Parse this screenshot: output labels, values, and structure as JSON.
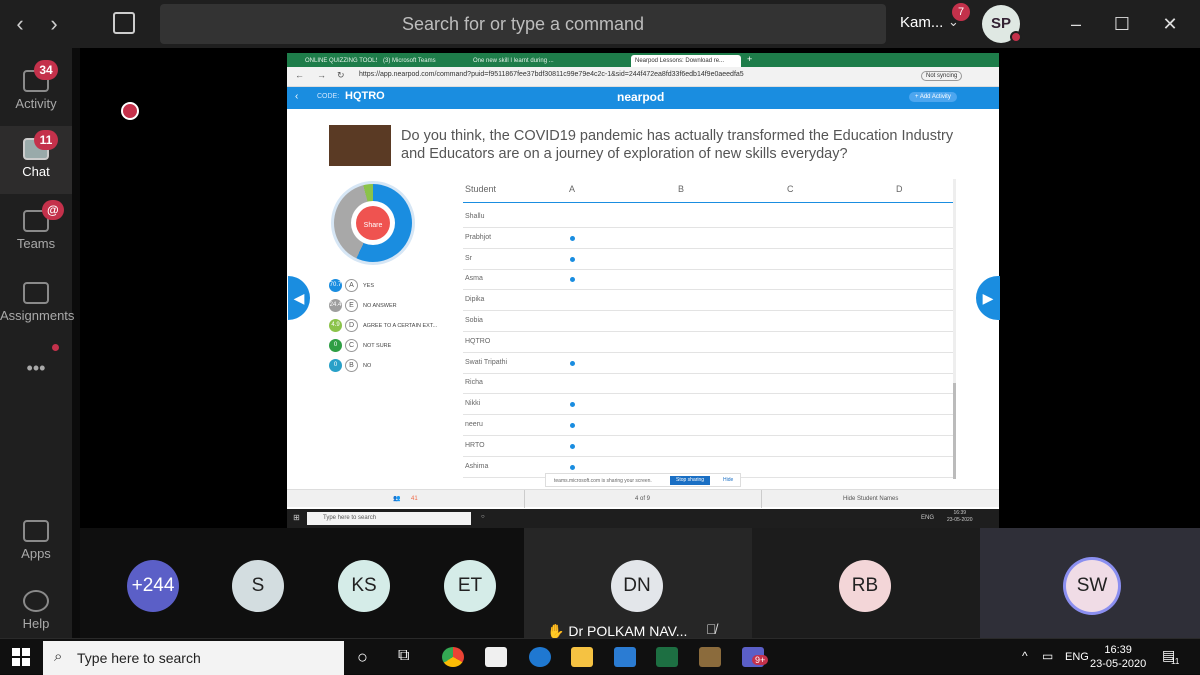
{
  "topbar": {
    "search_placeholder": "Search for or type a command",
    "user_name": "Kam...",
    "user_initials": "SP",
    "notification_count": "7"
  },
  "rail": {
    "items": [
      {
        "label": "Activity",
        "badge": "34"
      },
      {
        "label": "Chat",
        "badge": "11"
      },
      {
        "label": "Teams",
        "badge": "@"
      },
      {
        "label": "Assignments",
        "badge": ""
      },
      {
        "label": "•••",
        "badge": ""
      },
      {
        "label": "Apps",
        "badge": ""
      },
      {
        "label": "Help",
        "badge": ""
      }
    ]
  },
  "browser": {
    "tabs": [
      "ONLINE QUIZZING TOOLS",
      "(3) Microsoft Teams",
      "One new skill I learnt during ...",
      "Nearpod Lessons: Download re..."
    ],
    "url": "https://app.nearpod.com/command?puid=f9511867fee37bdf30811c99e79e4c2c-1&sid=244f472ea8fd33f6edb14f9e0aeedfa5",
    "sync_label": "Not syncing"
  },
  "nearpod": {
    "code_label": "CODE:",
    "code_value": "HQTRO",
    "logo": "nearpod",
    "add_activity": "+ Add Activity",
    "question": "Do you think, the COVID19 pandemic has actually transformed the Education Industry and Educators are on a journey of exploration of new skills everyday?",
    "share_label": "Share",
    "legend": [
      {
        "num": "70.7",
        "letter": "A",
        "text": "YES",
        "color": "#1a8de0"
      },
      {
        "num": "24.4",
        "letter": "E",
        "text": "NO ANSWER",
        "color": "#9e9e9e"
      },
      {
        "num": "4.9",
        "letter": "D",
        "text": "AGREE TO A CERTAIN EXT...",
        "color": "#8bc34a"
      },
      {
        "num": "0",
        "letter": "C",
        "text": "NOT SURE",
        "color": "#2e9e44"
      },
      {
        "num": "0",
        "letter": "B",
        "text": "NO",
        "color": "#28a0c8"
      }
    ],
    "table": {
      "headers": [
        "Student",
        "A",
        "B",
        "C",
        "D"
      ],
      "rows": [
        {
          "name": "Shallu",
          "a": false
        },
        {
          "name": "Prabhjot",
          "a": true
        },
        {
          "name": "Sr",
          "a": true
        },
        {
          "name": "Asma",
          "a": true
        },
        {
          "name": "Dipika",
          "a": false
        },
        {
          "name": "Sobia",
          "a": false
        },
        {
          "name": "HQTRO",
          "a": false
        },
        {
          "name": "Swati Tripathi",
          "a": true
        },
        {
          "name": "Richa",
          "a": false
        },
        {
          "name": "Nikki",
          "a": true
        },
        {
          "name": "neeru",
          "a": true
        },
        {
          "name": "HRTO",
          "a": true
        },
        {
          "name": "Ashima",
          "a": true
        }
      ]
    },
    "sharing_text": "teams.microsoft.com is sharing your screen.",
    "stop_sharing": "Stop sharing",
    "hide": "Hide",
    "participants": "41",
    "page": "4 of 9",
    "hide_names": "Hide Student Names"
  },
  "inner_taskbar": {
    "search": "Type here to search",
    "lang": "ENG",
    "time": "16:39",
    "date": "23-05-2020"
  },
  "participants": [
    {
      "initials": "+244",
      "color": "#5b5fc7",
      "text_color": "#ffffff"
    },
    {
      "initials": "S",
      "color": "#d3dde0",
      "text_color": "#222222"
    },
    {
      "initials": "KS",
      "color": "#d5ece8",
      "text_color": "#222222"
    },
    {
      "initials": "ET",
      "color": "#d5ece8",
      "text_color": "#222222"
    },
    {
      "initials": "DN",
      "color": "#e3e6ea",
      "text_color": "#222222"
    },
    {
      "initials": "RB",
      "color": "#f3d6d8",
      "text_color": "#222222"
    },
    {
      "initials": "SW",
      "color": "#f0dce6",
      "text_color": "#222222"
    }
  ],
  "presenter": {
    "name": "Dr POLKAM NAV..."
  },
  "taskbar": {
    "search": "Type here to search",
    "lang": "ENG",
    "time": "16:39",
    "date": "23-05-2020",
    "teams_badge": "9+",
    "notif_count": "11"
  }
}
